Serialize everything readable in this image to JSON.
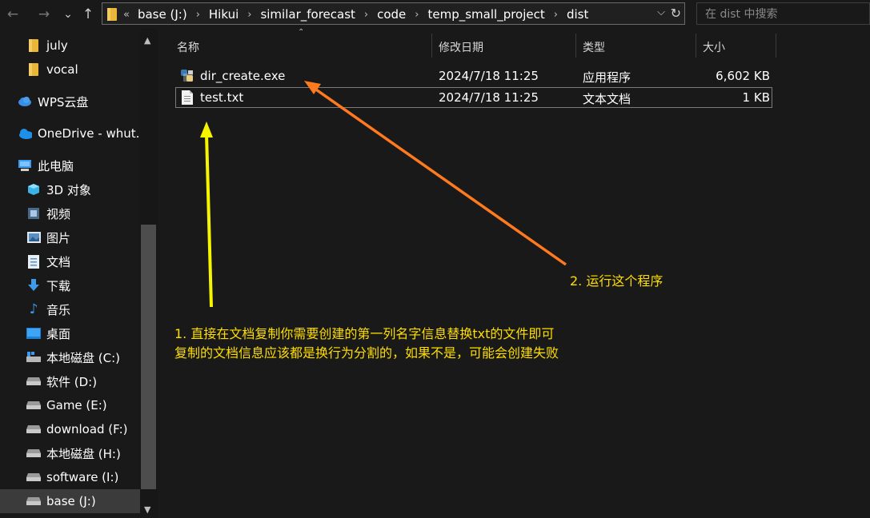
{
  "nav": {
    "back_icon": "←",
    "forward_icon": "→",
    "history_icon": "⌄",
    "up_icon": "↑"
  },
  "address": {
    "overflow": "«",
    "crumbs": [
      "base (J:)",
      "Hikui",
      "similar_forecast",
      "code",
      "temp_small_project",
      "dist"
    ],
    "separator": "›",
    "dropdown_icon": "⌵",
    "refresh_icon": "↻"
  },
  "search": {
    "placeholder": "在 dist 中搜索"
  },
  "sidebar": {
    "items": [
      {
        "label": "july",
        "icon": "folder-icon"
      },
      {
        "label": "vocal",
        "icon": "folder-icon"
      },
      {
        "label": "WPS云盘",
        "icon": "cloud-icon"
      },
      {
        "label": "OneDrive - whut.e",
        "icon": "onedrive-icon"
      },
      {
        "label": "此电脑",
        "icon": "computer-icon"
      },
      {
        "label": "3D 对象",
        "icon": "3d-objects-icon"
      },
      {
        "label": "视频",
        "icon": "video-icon"
      },
      {
        "label": "图片",
        "icon": "pictures-icon"
      },
      {
        "label": "文档",
        "icon": "documents-icon"
      },
      {
        "label": "下载",
        "icon": "download-icon"
      },
      {
        "label": "音乐",
        "icon": "music-icon"
      },
      {
        "label": "桌面",
        "icon": "desktop-icon"
      },
      {
        "label": "本地磁盘 (C:)",
        "icon": "system-drive-icon"
      },
      {
        "label": "软件 (D:)",
        "icon": "drive-icon"
      },
      {
        "label": "Game (E:)",
        "icon": "drive-icon"
      },
      {
        "label": "download (F:)",
        "icon": "drive-icon"
      },
      {
        "label": "本地磁盘 (H:)",
        "icon": "drive-icon"
      },
      {
        "label": "software (I:)",
        "icon": "drive-icon"
      },
      {
        "label": "base (J:)",
        "icon": "drive-icon",
        "selected": true
      }
    ]
  },
  "columns": {
    "name": "名称",
    "modified": "修改日期",
    "type": "类型",
    "size": "大小"
  },
  "files": [
    {
      "name": "dir_create.exe",
      "modified": "2024/7/18 11:25",
      "type": "应用程序",
      "size": "6,602 KB",
      "icon": "python-exe-icon"
    },
    {
      "name": "test.txt",
      "modified": "2024/7/18 11:25",
      "type": "文本文档",
      "size": "1 KB",
      "icon": "text-file-icon"
    }
  ],
  "annotations": {
    "step1_line1": "1. 直接在文档复制你需要创建的第一列名字信息替换txt的文件即可",
    "step1_line2": "复制的文档信息应该都是换行为分割的，如果不是，可能会创建失败",
    "step2": "2. 运行这个程序",
    "step1_color": "#ffde00",
    "step2_color": "#ffde00",
    "arrow1_color": "#f5f500",
    "arrow2_color": "#ff7a1f"
  },
  "colors": {
    "background": "#191919",
    "selected_sidebar": "#3b3b3b",
    "folder": "#e8b73a"
  }
}
